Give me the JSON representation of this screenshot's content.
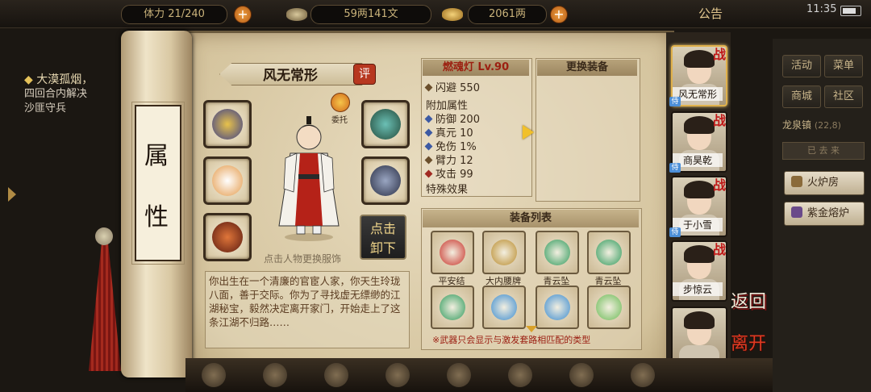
{
  "topbar": {
    "stamina_partial": "体力 21/240",
    "currency1": "59两141文",
    "currency2": "2061两",
    "notice": "公告",
    "time": "11:35",
    "plus": "+"
  },
  "quest": {
    "title": "大漠孤烟，",
    "line1": "四回合内解决",
    "line2": "沙匪守兵"
  },
  "scroll": {
    "chars": [
      "属",
      "性"
    ]
  },
  "character": {
    "name": "风无常形",
    "eval_badge": "评",
    "delegate_label": "委托",
    "unequip_label_1": "点击",
    "unequip_label_2": "卸下",
    "tap_hint": "点击人物更换服饰",
    "bio": "你出生在一个清廉的官宦人家，你天生玲珑八面，善于交际。你为了寻找虚无缥缈的江湖秘宝，毅然决定离开家门，开始走上了这条江湖不归路……"
  },
  "item_stats": {
    "title": "燃魂灯 Lv.90",
    "dodge_label": "闪避",
    "dodge_value": "550",
    "extra_title": "附加属性",
    "defense_label": "防御",
    "defense_value": "200",
    "zhenyuan_label": "真元",
    "zhenyuan_value": "10",
    "mianshang_label": "免伤",
    "mianshang_value": "1%",
    "bili_label": "臂力",
    "bili_value": "12",
    "attack_label": "攻击",
    "attack_value": "99",
    "special_title": "特殊效果"
  },
  "change_equip": {
    "title": "更换装备"
  },
  "equip_list": {
    "title": "装备列表",
    "items": [
      {
        "label": "平安结",
        "color": "#c8322a"
      },
      {
        "label": "大内腰牌",
        "color": "#b98b2c"
      },
      {
        "label": "青云坠",
        "color": "#2f9a5c"
      },
      {
        "label": "青云坠",
        "color": "#2f9a5c"
      },
      {
        "label": "",
        "color": "#2f9a5c"
      },
      {
        "label": "",
        "color": "#3a8bd0"
      },
      {
        "label": "",
        "color": "#3a8bd0"
      },
      {
        "label": "",
        "color": "#6aba55"
      }
    ],
    "note": "※武器只会显示与激发套路相匹配的类型"
  },
  "roster": [
    {
      "name": "风无常形",
      "tag": "战",
      "selected": true
    },
    {
      "name": "商昊乾",
      "tag": "战",
      "selected": false
    },
    {
      "name": "于小雪",
      "tag": "战",
      "selected": false
    },
    {
      "name": "步惊云",
      "tag": "战",
      "selected": false
    },
    {
      "name": "",
      "tag": "",
      "selected": false
    }
  ],
  "roster_badge": "侍",
  "actions": {
    "back": "返回",
    "leave": "离开"
  },
  "right_menu": {
    "activity": "活动",
    "menu": "菜单",
    "shop": "商城",
    "community": "社区",
    "location": "龙泉镇",
    "coords": "(22,8)",
    "bar_text": "已 去 来",
    "furnace": "火炉房",
    "purple_furnace": "紫金熔炉"
  }
}
